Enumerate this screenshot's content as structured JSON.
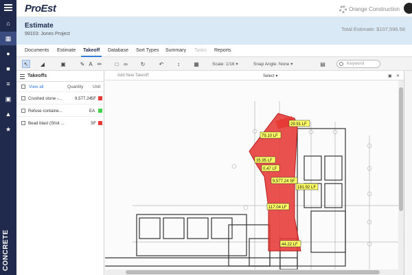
{
  "app": {
    "logo": "ProEst",
    "company": "Orange Construction"
  },
  "rail": {
    "vertical_label": "CONCRETE"
  },
  "header": {
    "title": "Estimate",
    "project": "99103: Jones Project",
    "total": "Total Estimate: $107,596.58"
  },
  "tabs": [
    {
      "label": "Documents"
    },
    {
      "label": "Estimate"
    },
    {
      "label": "Takeoff"
    },
    {
      "label": "Database"
    },
    {
      "label": "Sort Types"
    },
    {
      "label": "Summary"
    },
    {
      "label": "Tasks"
    },
    {
      "label": "Reports"
    }
  ],
  "toolbar": {
    "text_tool": "A",
    "scale": "Scale: 1/16 ▾",
    "snap": "Snap Angle: None ▾",
    "keyword_placeholder": "Keyword"
  },
  "panel": {
    "title": "Takeoffs",
    "view_all": "View all",
    "col_quantity": "Quantity",
    "col_unit": "Unit",
    "rows": [
      {
        "name": "Crushed stone -...",
        "quantity": "9,577.24",
        "unit": "SF",
        "color": "#e53935"
      },
      {
        "name": "Refuse containe...",
        "quantity": "",
        "unit": "EA",
        "color": "#43d04a"
      },
      {
        "name": "Bead blast (Shot ...",
        "quantity": "",
        "unit": "SF",
        "color": "#e53935"
      }
    ]
  },
  "plan_header": {
    "add_new": "Add New Takeoff",
    "select": "Select ▾"
  },
  "plan": {
    "measurements": [
      "29.91 LF",
      "79.10 LF",
      "35.95 LF",
      "0.47 LF",
      "9,577.24 SF",
      "181.92 LF",
      "117.04 LF",
      "44.22 LF"
    ]
  },
  "colors": {
    "rail": "#1f2a4d",
    "accent": "#2f7bd8",
    "header_band": "#d9e9f6",
    "takeoff_fill": "#e53935"
  }
}
